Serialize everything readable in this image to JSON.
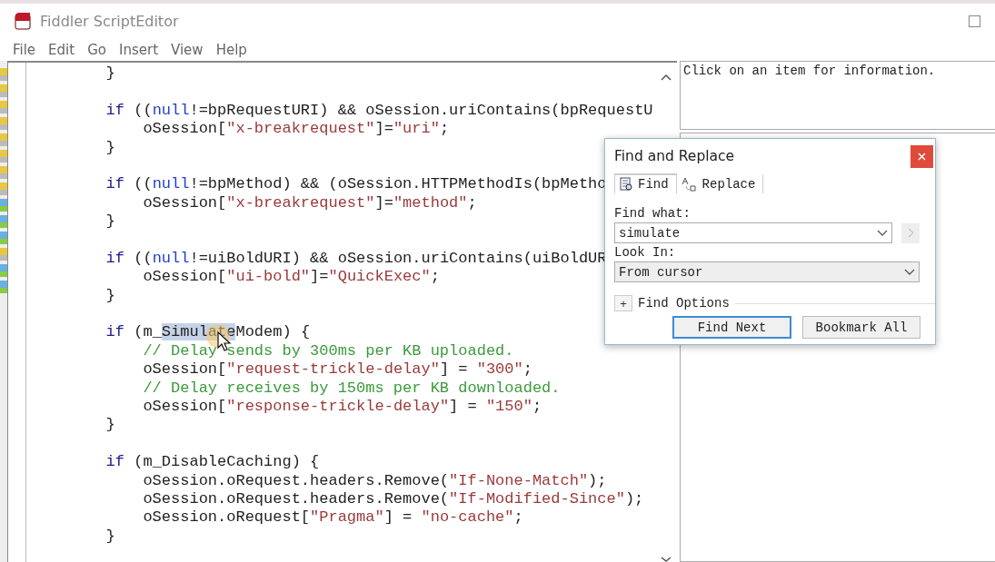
{
  "window": {
    "title": "Fiddler ScriptEditor"
  },
  "menu": [
    "File",
    "Edit",
    "Go",
    "Insert",
    "View",
    "Help"
  ],
  "editor": {
    "lines": [
      {
        "kind": "code",
        "tokens": [
          {
            "kind": "plain",
            "text": "        }"
          }
        ]
      },
      {
        "kind": "blank"
      },
      {
        "kind": "code",
        "tokens": [
          {
            "kind": "keyword",
            "text": "        if"
          },
          {
            "kind": "plain",
            "text": " (("
          },
          {
            "kind": "literal",
            "text": "null"
          },
          {
            "kind": "plain",
            "text": "!=bpRequestURI) && oSession.uriContains(bpRequestU"
          }
        ]
      },
      {
        "kind": "code",
        "tokens": [
          {
            "kind": "plain",
            "text": "            oSession["
          },
          {
            "kind": "string",
            "text": "\"x-breakrequest\""
          },
          {
            "kind": "plain",
            "text": "]="
          },
          {
            "kind": "string",
            "text": "\"uri\""
          },
          {
            "kind": "plain",
            "text": ";"
          }
        ]
      },
      {
        "kind": "code",
        "tokens": [
          {
            "kind": "plain",
            "text": "        }"
          }
        ]
      },
      {
        "kind": "blank"
      },
      {
        "kind": "code",
        "tokens": [
          {
            "kind": "keyword",
            "text": "        if"
          },
          {
            "kind": "plain",
            "text": " (("
          },
          {
            "kind": "literal",
            "text": "null"
          },
          {
            "kind": "plain",
            "text": "!=bpMethod) && (oSession.HTTPMethodIs(bpMetho"
          }
        ]
      },
      {
        "kind": "code",
        "tokens": [
          {
            "kind": "plain",
            "text": "            oSession["
          },
          {
            "kind": "string",
            "text": "\"x-breakrequest\""
          },
          {
            "kind": "plain",
            "text": "]="
          },
          {
            "kind": "string",
            "text": "\"method\""
          },
          {
            "kind": "plain",
            "text": ";"
          }
        ]
      },
      {
        "kind": "code",
        "tokens": [
          {
            "kind": "plain",
            "text": "        }"
          }
        ]
      },
      {
        "kind": "blank"
      },
      {
        "kind": "code",
        "tokens": [
          {
            "kind": "keyword",
            "text": "        if"
          },
          {
            "kind": "plain",
            "text": " (("
          },
          {
            "kind": "literal",
            "text": "null"
          },
          {
            "kind": "plain",
            "text": "!=uiBoldURI) && oSession.uriContains(uiBoldUR"
          }
        ]
      },
      {
        "kind": "code",
        "tokens": [
          {
            "kind": "plain",
            "text": "            oSession["
          },
          {
            "kind": "string",
            "text": "\"ui-bold\""
          },
          {
            "kind": "plain",
            "text": "]="
          },
          {
            "kind": "string",
            "text": "\"QuickExec\""
          },
          {
            "kind": "plain",
            "text": ";"
          }
        ]
      },
      {
        "kind": "code",
        "tokens": [
          {
            "kind": "plain",
            "text": "        }"
          }
        ]
      },
      {
        "kind": "blank"
      },
      {
        "kind": "code",
        "tokens": [
          {
            "kind": "keyword",
            "text": "        if"
          },
          {
            "kind": "plain",
            "text": " (m_"
          },
          {
            "kind": "match",
            "text": "Simulate"
          },
          {
            "kind": "plain",
            "text": "Modem) {"
          }
        ]
      },
      {
        "kind": "code",
        "tokens": [
          {
            "kind": "comment",
            "text": "            // Delay sends by 300ms per KB uploaded."
          }
        ]
      },
      {
        "kind": "code",
        "tokens": [
          {
            "kind": "plain",
            "text": "            oSession["
          },
          {
            "kind": "string",
            "text": "\"request-trickle-delay\""
          },
          {
            "kind": "plain",
            "text": "] = "
          },
          {
            "kind": "string",
            "text": "\"300\""
          },
          {
            "kind": "plain",
            "text": ";"
          }
        ]
      },
      {
        "kind": "code",
        "tokens": [
          {
            "kind": "comment",
            "text": "            // Delay receives by 150ms per KB downloaded."
          }
        ]
      },
      {
        "kind": "code",
        "tokens": [
          {
            "kind": "plain",
            "text": "            oSession["
          },
          {
            "kind": "string",
            "text": "\"response-trickle-delay\""
          },
          {
            "kind": "plain",
            "text": "] = "
          },
          {
            "kind": "string",
            "text": "\"150\""
          },
          {
            "kind": "plain",
            "text": ";"
          }
        ]
      },
      {
        "kind": "code",
        "tokens": [
          {
            "kind": "plain",
            "text": "        }"
          }
        ]
      },
      {
        "kind": "blank"
      },
      {
        "kind": "code",
        "tokens": [
          {
            "kind": "keyword",
            "text": "        if"
          },
          {
            "kind": "plain",
            "text": " (m_DisableCaching) {"
          }
        ]
      },
      {
        "kind": "code",
        "tokens": [
          {
            "kind": "plain",
            "text": "            oSession.oRequest.headers.Remove("
          },
          {
            "kind": "string",
            "text": "\"If-None-Match\""
          },
          {
            "kind": "plain",
            "text": ");"
          }
        ]
      },
      {
        "kind": "code",
        "tokens": [
          {
            "kind": "plain",
            "text": "            oSession.oRequest.headers.Remove("
          },
          {
            "kind": "string",
            "text": "\"If-Modified-Since\""
          },
          {
            "kind": "plain",
            "text": ");"
          }
        ]
      },
      {
        "kind": "code",
        "tokens": [
          {
            "kind": "plain",
            "text": "            oSession.oRequest["
          },
          {
            "kind": "string",
            "text": "\"Pragma\""
          },
          {
            "kind": "plain",
            "text": "] = "
          },
          {
            "kind": "string",
            "text": "\"no-cache\""
          },
          {
            "kind": "plain",
            "text": ";"
          }
        ]
      },
      {
        "kind": "code",
        "tokens": [
          {
            "kind": "plain",
            "text": "        }"
          }
        ]
      }
    ]
  },
  "info_panel": {
    "text": "Click on an item for information."
  },
  "dialog": {
    "title": "Find and Replace",
    "tabs": [
      {
        "label": "Find",
        "selected": true
      },
      {
        "label": "Replace",
        "selected": false
      }
    ],
    "find_label": "Find what:",
    "find_value": "simulate",
    "look_label": "Look In:",
    "look_value": "From cursor",
    "options": {
      "label": "Find Options",
      "expander": "+",
      "expanded": false
    },
    "buttons": [
      {
        "label": "Find Next",
        "default": true
      },
      {
        "label": "Bookmark All",
        "default": false
      }
    ]
  }
}
